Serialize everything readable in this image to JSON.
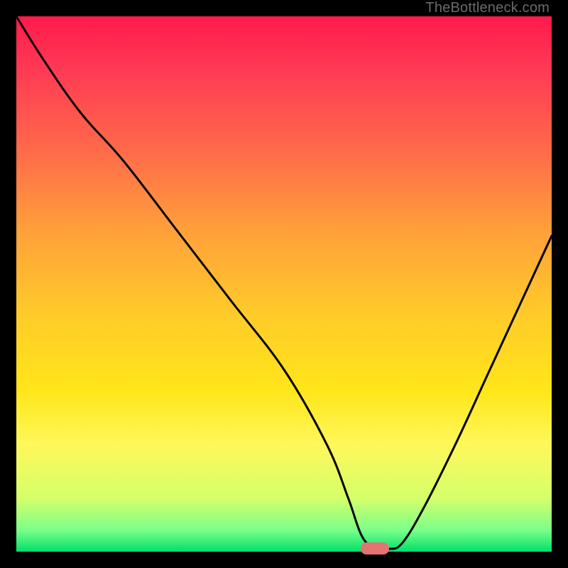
{
  "watermark": "TheBottleneck.com",
  "colors": {
    "curve_stroke": "#000000",
    "marker_fill": "#e57373"
  },
  "chart_data": {
    "type": "line",
    "title": "",
    "xlabel": "",
    "ylabel": "",
    "xlim": [
      0,
      100
    ],
    "ylim": [
      0,
      100
    ],
    "grid": false,
    "legend": false,
    "series": [
      {
        "name": "bottleneck-curve",
        "x": [
          0,
          5,
          12,
          20,
          30,
          40,
          50,
          58,
          62,
          64.5,
          67,
          69.5,
          72,
          76,
          82,
          88,
          94,
          100
        ],
        "y": [
          100,
          92,
          82,
          73,
          60,
          47,
          34,
          20,
          10,
          3,
          0.5,
          0.5,
          1.5,
          8,
          20,
          33,
          46,
          59
        ]
      }
    ],
    "marker": {
      "x": 67,
      "y": 0.7
    },
    "gradient_stops": [
      {
        "pct": 0,
        "color": "#ff1a4d"
      },
      {
        "pct": 10,
        "color": "#ff3a54"
      },
      {
        "pct": 25,
        "color": "#ff6a4a"
      },
      {
        "pct": 40,
        "color": "#ffa03a"
      },
      {
        "pct": 55,
        "color": "#ffc92a"
      },
      {
        "pct": 70,
        "color": "#ffe61a"
      },
      {
        "pct": 80,
        "color": "#fff85a"
      },
      {
        "pct": 90,
        "color": "#d5ff6a"
      },
      {
        "pct": 96,
        "color": "#7aff8a"
      },
      {
        "pct": 100,
        "color": "#00e06a"
      }
    ]
  }
}
